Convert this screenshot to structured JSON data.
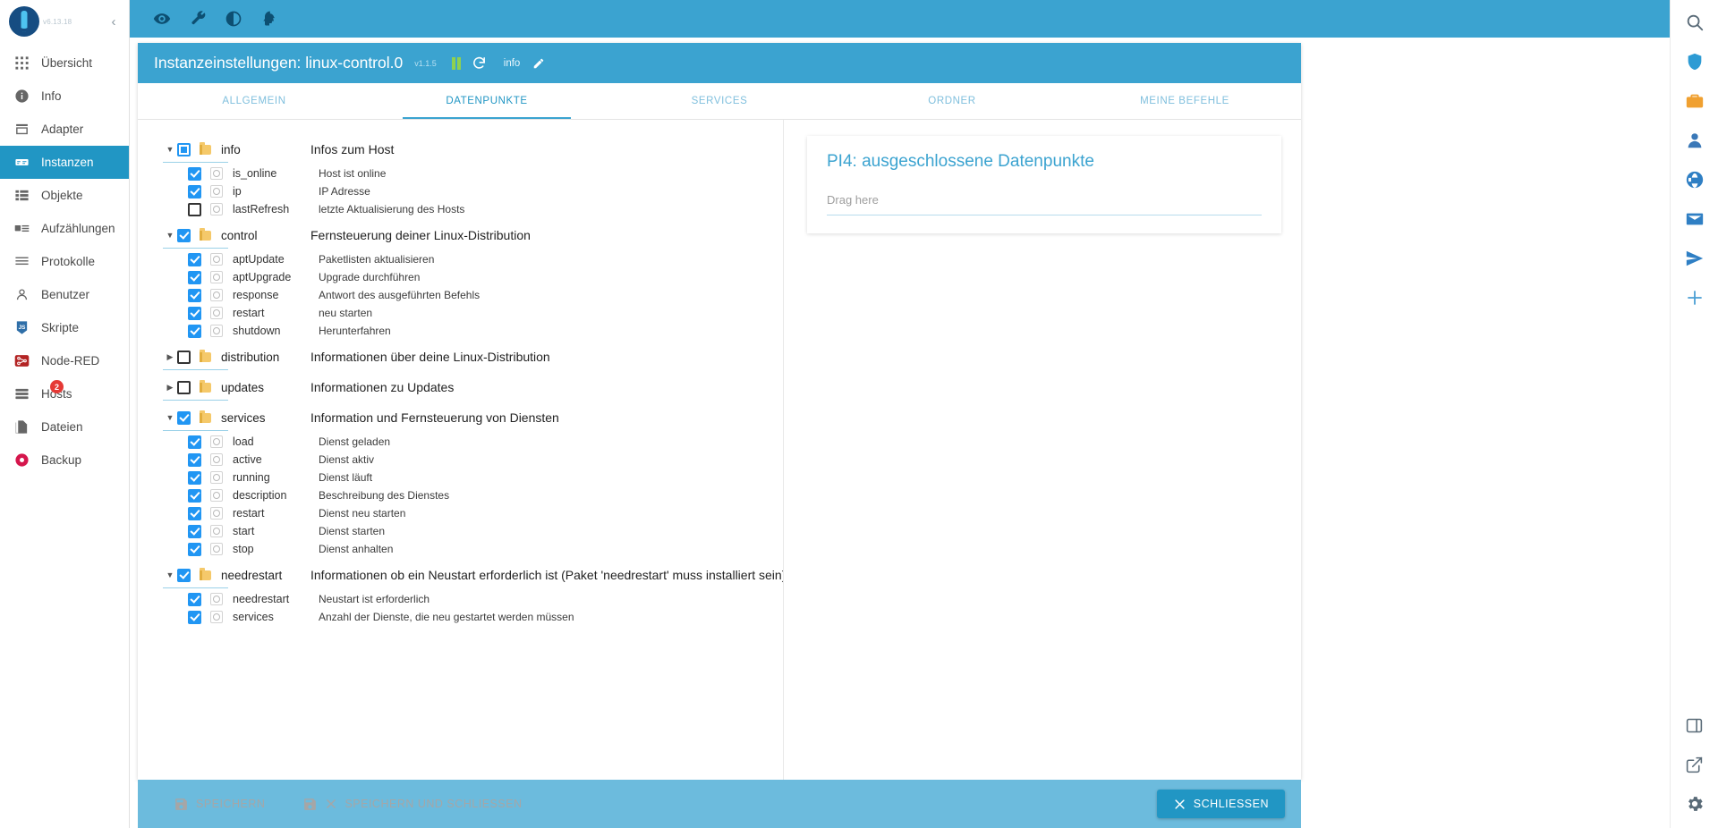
{
  "sidebar": {
    "version": "v6.13.18",
    "collapse_label": "‹",
    "items": [
      {
        "label": "Übersicht",
        "icon": "grid-icon",
        "active": false
      },
      {
        "label": "Info",
        "icon": "info-icon",
        "active": false
      },
      {
        "label": "Adapter",
        "icon": "store-icon",
        "active": false
      },
      {
        "label": "Instanzen",
        "icon": "instances-icon",
        "active": true
      },
      {
        "label": "Objekte",
        "icon": "list-icon",
        "active": false
      },
      {
        "label": "Aufzählungen",
        "icon": "enum-icon",
        "active": false
      },
      {
        "label": "Protokolle",
        "icon": "log-icon",
        "active": false
      },
      {
        "label": "Benutzer",
        "icon": "user-icon",
        "active": false
      },
      {
        "label": "Skripte",
        "icon": "js-icon",
        "active": false
      },
      {
        "label": "Node-RED",
        "icon": "nodered-icon",
        "active": false
      },
      {
        "label": "Hosts",
        "icon": "hosts-icon",
        "active": false,
        "badge": "2"
      },
      {
        "label": "Dateien",
        "icon": "files-icon",
        "active": false
      },
      {
        "label": "Backup",
        "icon": "backup-icon",
        "active": false
      }
    ]
  },
  "toolbar": {
    "icons": [
      "eye-icon",
      "wrench-icon",
      "contrast-icon",
      "expert-icon"
    ]
  },
  "dialog": {
    "title": "Instanzeinstellungen: linux-control.0",
    "version": "v1.1.5",
    "pause_icon": "pause-icon",
    "refresh_icon": "refresh-icon",
    "info_label": "info",
    "edit_icon": "pencil-icon"
  },
  "tabs": [
    {
      "label": "ALLGEMEIN",
      "active": false
    },
    {
      "label": "DATENPUNKTE",
      "active": true
    },
    {
      "label": "SERVICES",
      "active": false
    },
    {
      "label": "ORDNER",
      "active": false
    },
    {
      "label": "MEINE BEFEHLE",
      "active": false
    }
  ],
  "tree": [
    {
      "id": "info",
      "desc": "Infos zum Host",
      "state": "indeterminate",
      "expanded": true,
      "children": [
        {
          "id": "is_online",
          "desc": "Host ist online",
          "checked": true
        },
        {
          "id": "ip",
          "desc": "IP Adresse",
          "checked": true
        },
        {
          "id": "lastRefresh",
          "desc": "letzte Aktualisierung des Hosts",
          "checked": false
        }
      ]
    },
    {
      "id": "control",
      "desc": "Fernsteuerung deiner Linux-Distribution",
      "state": "checked",
      "expanded": true,
      "children": [
        {
          "id": "aptUpdate",
          "desc": "Paketlisten aktualisieren",
          "checked": true
        },
        {
          "id": "aptUpgrade",
          "desc": "Upgrade durchführen",
          "checked": true
        },
        {
          "id": "response",
          "desc": "Antwort des ausgeführten Befehls",
          "checked": true
        },
        {
          "id": "restart",
          "desc": "neu starten",
          "checked": true
        },
        {
          "id": "shutdown",
          "desc": "Herunterfahren",
          "checked": true
        }
      ]
    },
    {
      "id": "distribution",
      "desc": "Informationen über deine Linux-Distribution",
      "state": "unchecked",
      "expanded": false,
      "children": []
    },
    {
      "id": "updates",
      "desc": "Informationen zu Updates",
      "state": "unchecked",
      "expanded": false,
      "children": []
    },
    {
      "id": "services",
      "desc": "Information und Fernsteuerung von Diensten",
      "state": "checked",
      "expanded": true,
      "children": [
        {
          "id": "load",
          "desc": "Dienst geladen",
          "checked": true
        },
        {
          "id": "active",
          "desc": "Dienst aktiv",
          "checked": true
        },
        {
          "id": "running",
          "desc": "Dienst läuft",
          "checked": true
        },
        {
          "id": "description",
          "desc": "Beschreibung des Dienstes",
          "checked": true
        },
        {
          "id": "restart",
          "desc": "Dienst neu starten",
          "checked": true
        },
        {
          "id": "start",
          "desc": "Dienst starten",
          "checked": true
        },
        {
          "id": "stop",
          "desc": "Dienst anhalten",
          "checked": true
        }
      ]
    },
    {
      "id": "needrestart",
      "desc": "Informationen ob ein Neustart erforderlich ist (Paket 'needrestart' muss installiert sein)",
      "state": "checked",
      "expanded": true,
      "children": [
        {
          "id": "needrestart",
          "desc": "Neustart ist erforderlich",
          "checked": true
        },
        {
          "id": "services",
          "desc": "Anzahl der Dienste, die neu gestartet werden müssen",
          "checked": true
        }
      ]
    }
  ],
  "excluded_panel": {
    "title": "PI4: ausgeschlossene Datenpunkte",
    "drop_placeholder": "Drag here"
  },
  "footer": {
    "save_label": "SPEICHERN",
    "save_close_label": "SPEICHERN UND SCHLIESSEN",
    "close_label": "SCHLIESSEN"
  },
  "rail": {
    "icons": [
      "search-icon",
      "shield-icon",
      "briefcase-icon",
      "person-icon",
      "globe-icon",
      "mail-icon",
      "send-icon",
      "plus-icon"
    ],
    "bottom_icons": [
      "window-icon",
      "external-link-icon",
      "gear-icon"
    ]
  },
  "colors": {
    "accent": "#3ba3d0",
    "active_nav": "#2196c4",
    "checkbox": "#2196f3",
    "badge": "#e53935",
    "folder": "#f5c96a"
  }
}
